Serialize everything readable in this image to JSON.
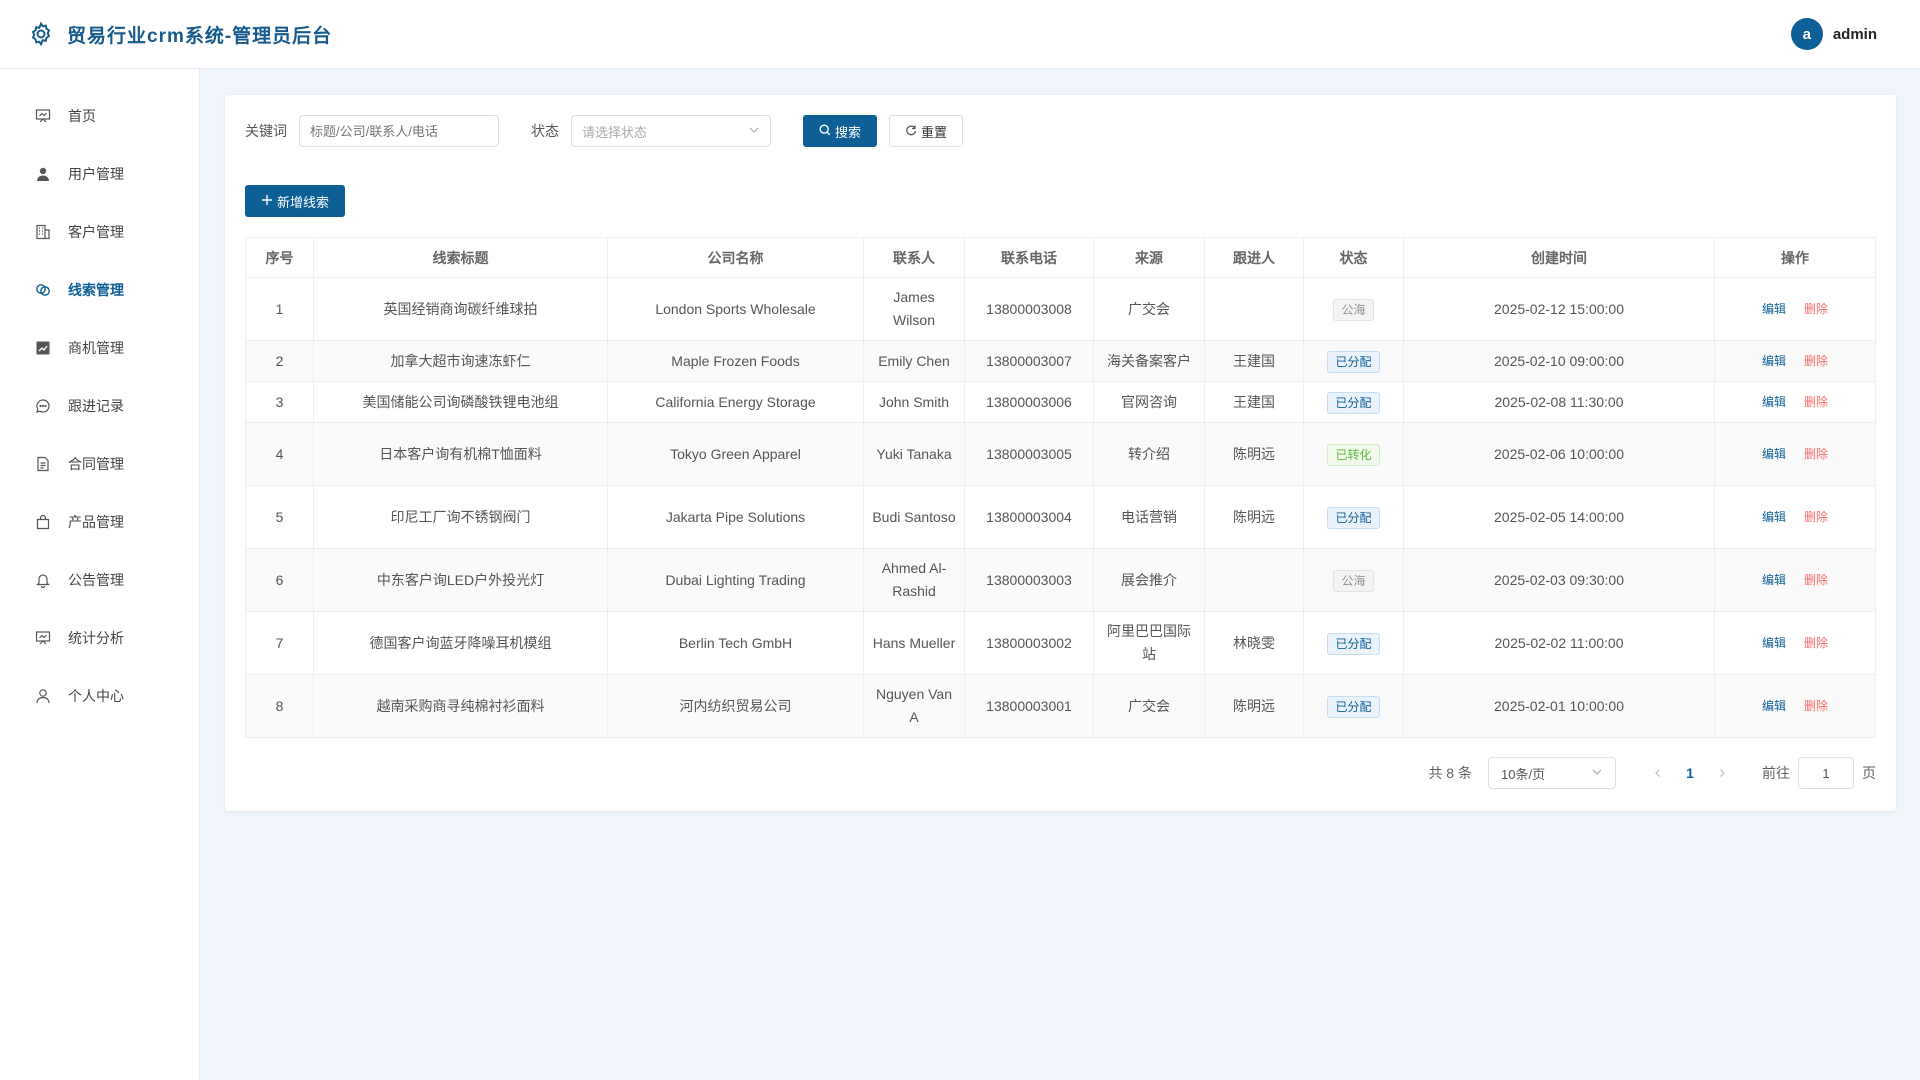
{
  "header": {
    "title": "贸易行业crm系统-管理员后台",
    "brand_icon": "gear-icon",
    "avatar_letter": "a",
    "username": "admin"
  },
  "sidebar": {
    "items": [
      {
        "label": "首页",
        "icon": "presentation-icon",
        "active": false
      },
      {
        "label": "用户管理",
        "icon": "user-icon",
        "active": false
      },
      {
        "label": "客户管理",
        "icon": "building-icon",
        "active": false
      },
      {
        "label": "线索管理",
        "icon": "link-icon",
        "active": true
      },
      {
        "label": "商机管理",
        "icon": "chart-icon",
        "active": false
      },
      {
        "label": "跟进记录",
        "icon": "chat-icon",
        "active": false
      },
      {
        "label": "合同管理",
        "icon": "document-icon",
        "active": false
      },
      {
        "label": "产品管理",
        "icon": "bag-icon",
        "active": false
      },
      {
        "label": "公告管理",
        "icon": "bell-icon",
        "active": false
      },
      {
        "label": "统计分析",
        "icon": "presentation-icon",
        "active": false
      },
      {
        "label": "个人中心",
        "icon": "user-outline-icon",
        "active": false
      }
    ]
  },
  "filters": {
    "keyword_label": "关键词",
    "keyword_placeholder": "标题/公司/联系人/电话",
    "status_label": "状态",
    "status_placeholder": "请选择状态",
    "search_label": "搜索",
    "reset_label": "重置"
  },
  "add_button_label": "新增线索",
  "table": {
    "columns": [
      "序号",
      "线索标题",
      "公司名称",
      "联系人",
      "联系电话",
      "来源",
      "跟进人",
      "状态",
      "创建时间",
      "操作"
    ],
    "edit_label": "编辑",
    "delete_label": "删除",
    "rows": [
      {
        "no": "1",
        "title": "英国经销商询碳纤维球拍",
        "company": "London Sports Wholesale",
        "contact": "James Wilson",
        "phone": "13800003008",
        "source": "广交会",
        "owner": "",
        "status": "公海",
        "status_color": "gray",
        "created": "2025-02-12 15:00:00"
      },
      {
        "no": "2",
        "title": "加拿大超市询速冻虾仁",
        "company": "Maple Frozen Foods",
        "contact": "Emily Chen",
        "phone": "13800003007",
        "source": "海关备案客户",
        "owner": "王建国",
        "status": "已分配",
        "status_color": "blue",
        "created": "2025-02-10 09:00:00"
      },
      {
        "no": "3",
        "title": "美国储能公司询磷酸铁锂电池组",
        "company": "California Energy Storage",
        "contact": "John Smith",
        "phone": "13800003006",
        "source": "官网咨询",
        "owner": "王建国",
        "status": "已分配",
        "status_color": "blue",
        "created": "2025-02-08 11:30:00"
      },
      {
        "no": "4",
        "title": "日本客户询有机棉T恤面料",
        "company": "Tokyo Green Apparel",
        "contact": "Yuki Tanaka",
        "phone": "13800003005",
        "source": "转介绍",
        "owner": "陈明远",
        "status": "已转化",
        "status_color": "green",
        "created": "2025-02-06 10:00:00"
      },
      {
        "no": "5",
        "title": "印尼工厂询不锈钢阀门",
        "company": "Jakarta Pipe Solutions",
        "contact": "Budi Santoso",
        "phone": "13800003004",
        "source": "电话营销",
        "owner": "陈明远",
        "status": "已分配",
        "status_color": "blue",
        "created": "2025-02-05 14:00:00"
      },
      {
        "no": "6",
        "title": "中东客户询LED户外投光灯",
        "company": "Dubai Lighting Trading",
        "contact": "Ahmed Al-Rashid",
        "phone": "13800003003",
        "source": "展会推介",
        "owner": "",
        "status": "公海",
        "status_color": "gray",
        "created": "2025-02-03 09:30:00"
      },
      {
        "no": "7",
        "title": "德国客户询蓝牙降噪耳机模组",
        "company": "Berlin Tech GmbH",
        "contact": "Hans Mueller",
        "phone": "13800003002",
        "source": "阿里巴巴国际站",
        "owner": "林晓雯",
        "status": "已分配",
        "status_color": "blue",
        "created": "2025-02-02 11:00:00"
      },
      {
        "no": "8",
        "title": "越南采购商寻纯棉衬衫面料",
        "company": "河内纺织贸易公司",
        "contact": "Nguyen Van A",
        "phone": "13800003001",
        "source": "广交会",
        "owner": "陈明远",
        "status": "已分配",
        "status_color": "blue",
        "created": "2025-02-01 10:00:00"
      }
    ]
  },
  "pagination": {
    "total_text": "共 8 条",
    "page_size": "10条/页",
    "current_page": "1",
    "goto_label": "前往",
    "goto_value": "1",
    "page_suffix": "页"
  }
}
